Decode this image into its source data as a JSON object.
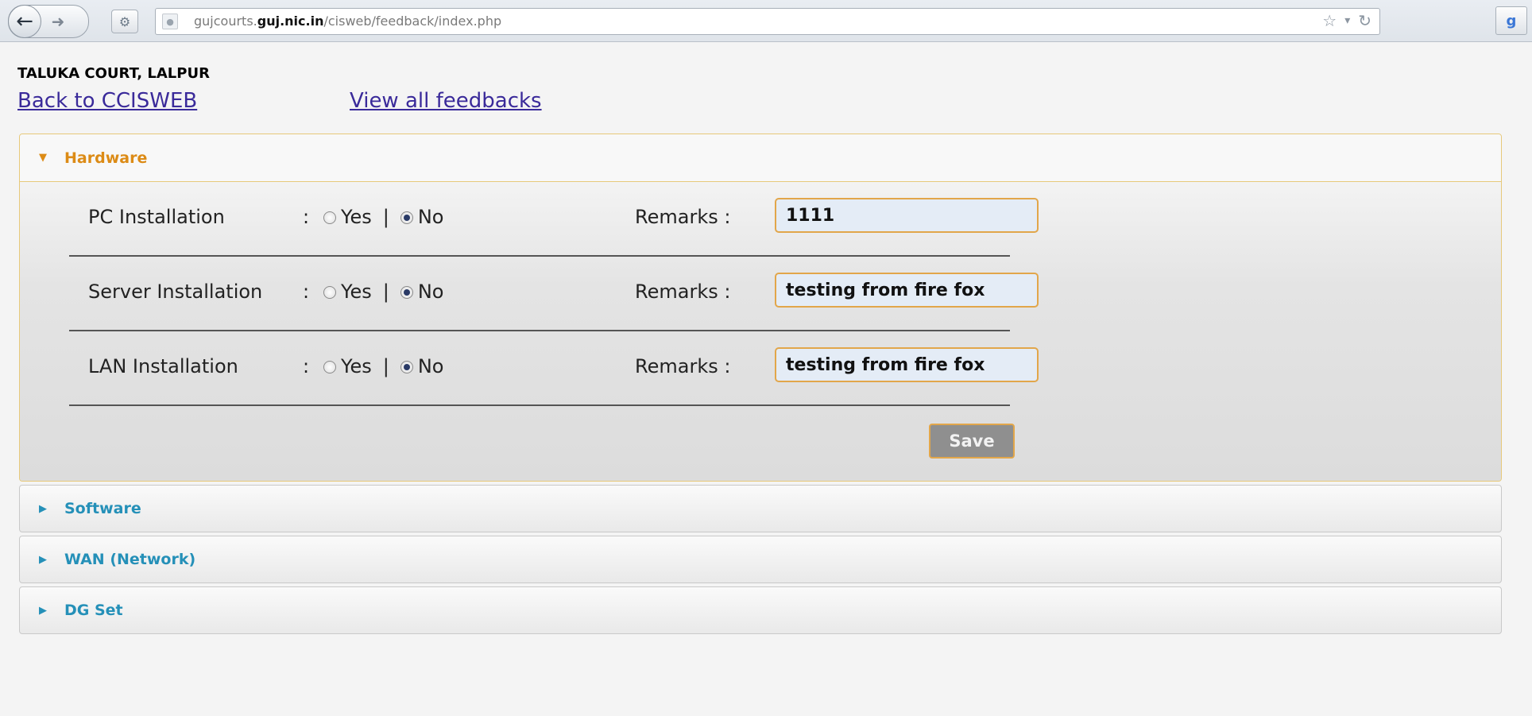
{
  "browser": {
    "url_prefix": "gujcourts.",
    "url_domain": "guj.nic.in",
    "url_path": "/cisweb/feedback/index.php"
  },
  "page": {
    "court_name": "TALUKA COURT, LALPUR",
    "back_link": "Back to CCISWEB",
    "view_all_link": "View all feedbacks"
  },
  "panels": [
    {
      "title": "Hardware",
      "expanded": true,
      "rows": [
        {
          "label": "PC Installation",
          "colon": ":",
          "yes": "Yes",
          "separator": "|",
          "no": "No",
          "selected": "No",
          "remarks_label": "Remarks :",
          "remarks_value": "1111"
        },
        {
          "label": "Server Installation",
          "colon": ":",
          "yes": "Yes",
          "separator": "|",
          "no": "No",
          "selected": "No",
          "remarks_label": "Remarks :",
          "remarks_value": "testing from fire fox"
        },
        {
          "label": "LAN Installation",
          "colon": ":",
          "yes": "Yes",
          "separator": "|",
          "no": "No",
          "selected": "No",
          "remarks_label": "Remarks :",
          "remarks_value": "testing from fire fox"
        }
      ],
      "save_label": "Save"
    },
    {
      "title": "Software",
      "expanded": false
    },
    {
      "title": "WAN (Network)",
      "expanded": false
    },
    {
      "title": "DG Set",
      "expanded": false
    }
  ],
  "colors": {
    "active_header": "#dc8b16",
    "collapsed_header": "#2590b8",
    "input_border": "#e2a64a"
  }
}
